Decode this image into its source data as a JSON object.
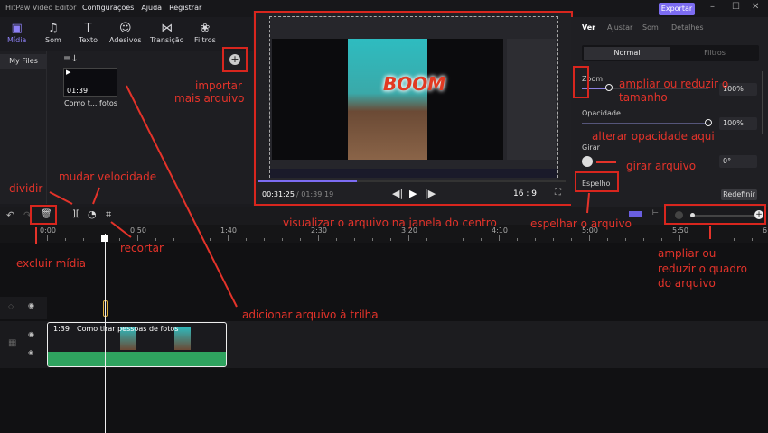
{
  "app": {
    "title": "HitPaw Video Editor",
    "menu": [
      "Configurações",
      "Ajuda",
      "Registrar"
    ],
    "export_label": "Exportar"
  },
  "toolbar": [
    {
      "label": "Mídia",
      "icon": "media-icon"
    },
    {
      "label": "Som",
      "icon": "music-icon"
    },
    {
      "label": "Texto",
      "icon": "text-icon"
    },
    {
      "label": "Adesivos",
      "icon": "sticker-icon"
    },
    {
      "label": "Transição",
      "icon": "transition-icon"
    },
    {
      "label": "Filtros",
      "icon": "filters-icon"
    }
  ],
  "left": {
    "tab": "My Files"
  },
  "media": {
    "items": [
      {
        "duration": "01:39",
        "name": "Como t... fotos"
      }
    ]
  },
  "preview": {
    "current_time": "00:31:25",
    "total_time": "/ 01:39:19",
    "ratio": "16 : 9",
    "progress": 0.32,
    "sticker_text": "BOOM"
  },
  "right": {
    "tabs": [
      "Ver",
      "Ajustar",
      "Som",
      "Detalhes"
    ],
    "modes": [
      "Normal",
      "Filtros"
    ],
    "zoom": {
      "label": "Zoom",
      "value": "100%"
    },
    "opacity": {
      "label": "Opacidade",
      "value": "100%"
    },
    "rotate": {
      "label": "Girar",
      "value": "0°"
    },
    "mirror": {
      "label": "Espelho"
    },
    "reset_label": "Redefinir"
  },
  "timeline": {
    "ruler": [
      "0:00",
      "0:50",
      "1:40",
      "2:30",
      "3:20",
      "4:10",
      "5:00",
      "5:50",
      "6"
    ],
    "clip": {
      "duration": "1:39",
      "name": "Como tirar pessoas de fotos"
    }
  },
  "annotations": {
    "import": "importar",
    "import2": "mais arquivo",
    "zoom": "ampliar ou reduzir o",
    "zoom2": "tamanho",
    "opacity": "alterar opacidade aqui",
    "rotate": "girar arquivo",
    "speed": "mudar velocidade",
    "split": "dividir",
    "delete": "excluir mídia",
    "crop": "recortar",
    "preview": "visualizar o arquivo na janela do centro",
    "mirror": "espelhar o arquivo",
    "frame": "ampliar ou",
    "frame2": "reduzir o quadro",
    "frame3": "do arquivo",
    "add": "adicionar arquivo à trilha"
  },
  "colors": {
    "accent": "#7c6cf2",
    "annotation": "#e4332a",
    "audio": "#2fa35f"
  }
}
